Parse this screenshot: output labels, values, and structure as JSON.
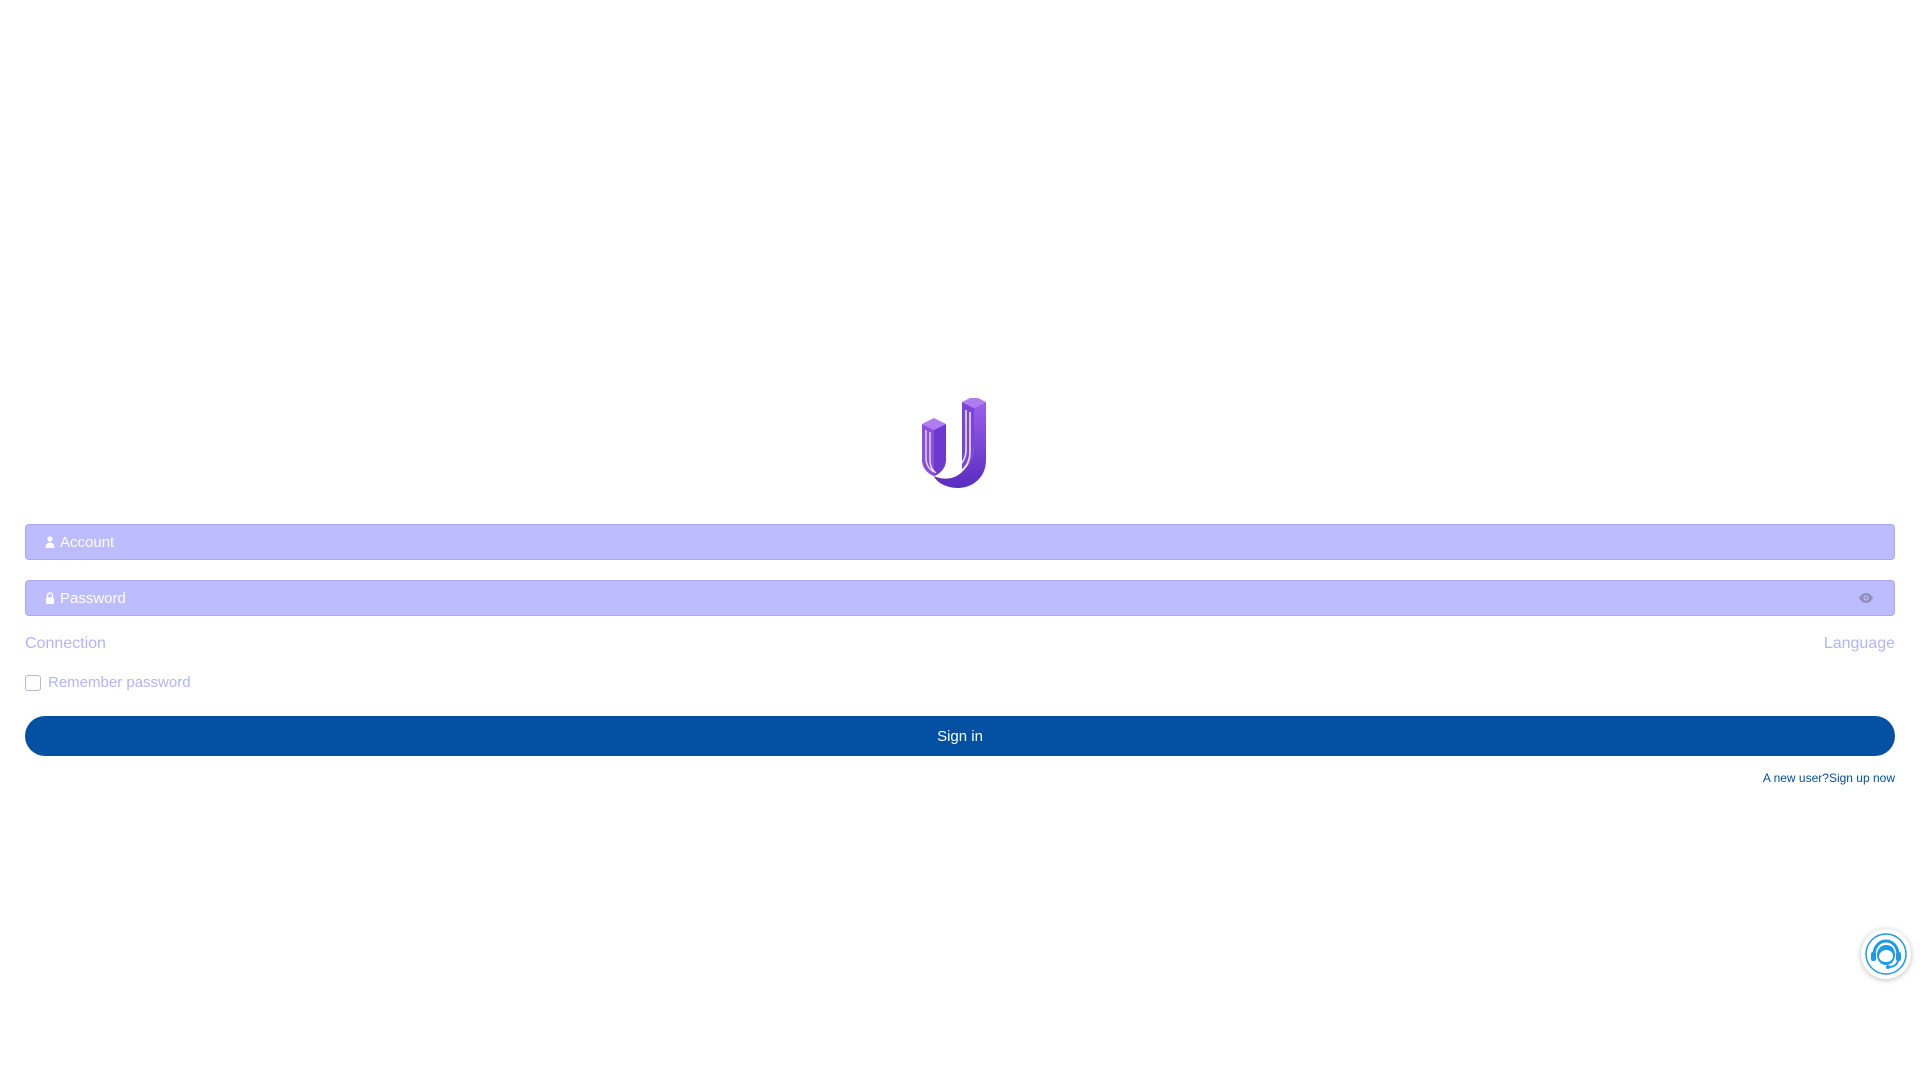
{
  "logo": {
    "name": "u-logo",
    "colors": {
      "primary": "#8a4fe0",
      "secondary": "#5a2cc0"
    }
  },
  "form": {
    "account_placeholder": "Account",
    "password_placeholder": "Password",
    "account_icon": "user-icon",
    "password_icon": "lock-icon",
    "toggle_icon": "eye-icon",
    "field_color": "#bcbcff"
  },
  "links": {
    "connection": "Connection",
    "language": "Language"
  },
  "remember": {
    "label": "Remember password",
    "checked": false
  },
  "signin": {
    "label": "Sign in",
    "color": "#0450a2"
  },
  "signup": {
    "prompt": "A new user?",
    "link": "Sign up now"
  },
  "support": {
    "icon": "customer-support-icon",
    "color": "#1e9be8"
  }
}
